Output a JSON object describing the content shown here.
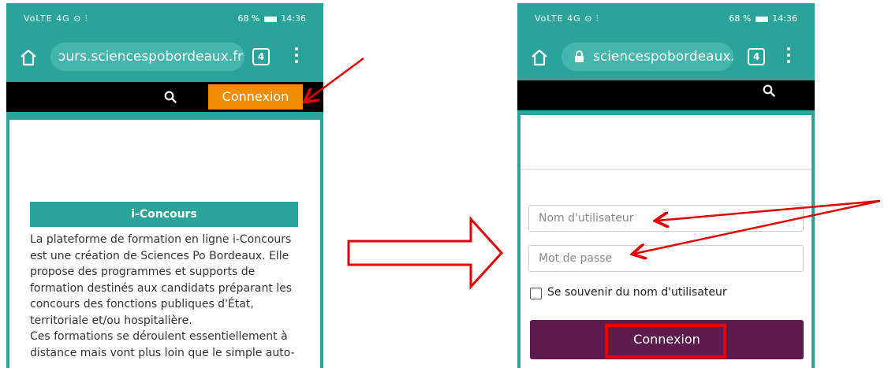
{
  "left_screen": {
    "status": {
      "left": "VoLTE 4G ⊙ ⫶",
      "battery_pct": "68 %",
      "time": "14:36"
    },
    "url": "ɔurs.sciencespobordeaux.fr",
    "tab_count": "4",
    "connexion_button": "Connexion",
    "section_title": "i-Concours",
    "paragraph_1": "La plateforme de formation en ligne i-Concours est une création de Sciences Po Bordeaux. Elle propose des programmes et supports de formation destinés aux candidats préparant les concours des fonctions publiques d'État, territoriale et/ou hospitalière.",
    "paragraph_2": "Ces formations se déroulent essentiellement à distance mais vont plus loin que le simple auto-"
  },
  "right_screen": {
    "status": {
      "left": "VoLTE 4G ⊙ ⫶",
      "battery_pct": "68 %",
      "time": "14:36"
    },
    "url": "sciencespobordeaux.fr",
    "tab_count": "4",
    "username_placeholder": "Nom d'utilisateur",
    "password_placeholder": "Mot de passe",
    "remember_label": "Se souvenir du nom d'utilisateur",
    "connexion_button": "Connexion"
  },
  "annotation_color": "#e60000",
  "icons": [
    "home-icon",
    "search-icon",
    "menu-icon",
    "lock-icon",
    "tabs-icon",
    "battery-icon"
  ]
}
